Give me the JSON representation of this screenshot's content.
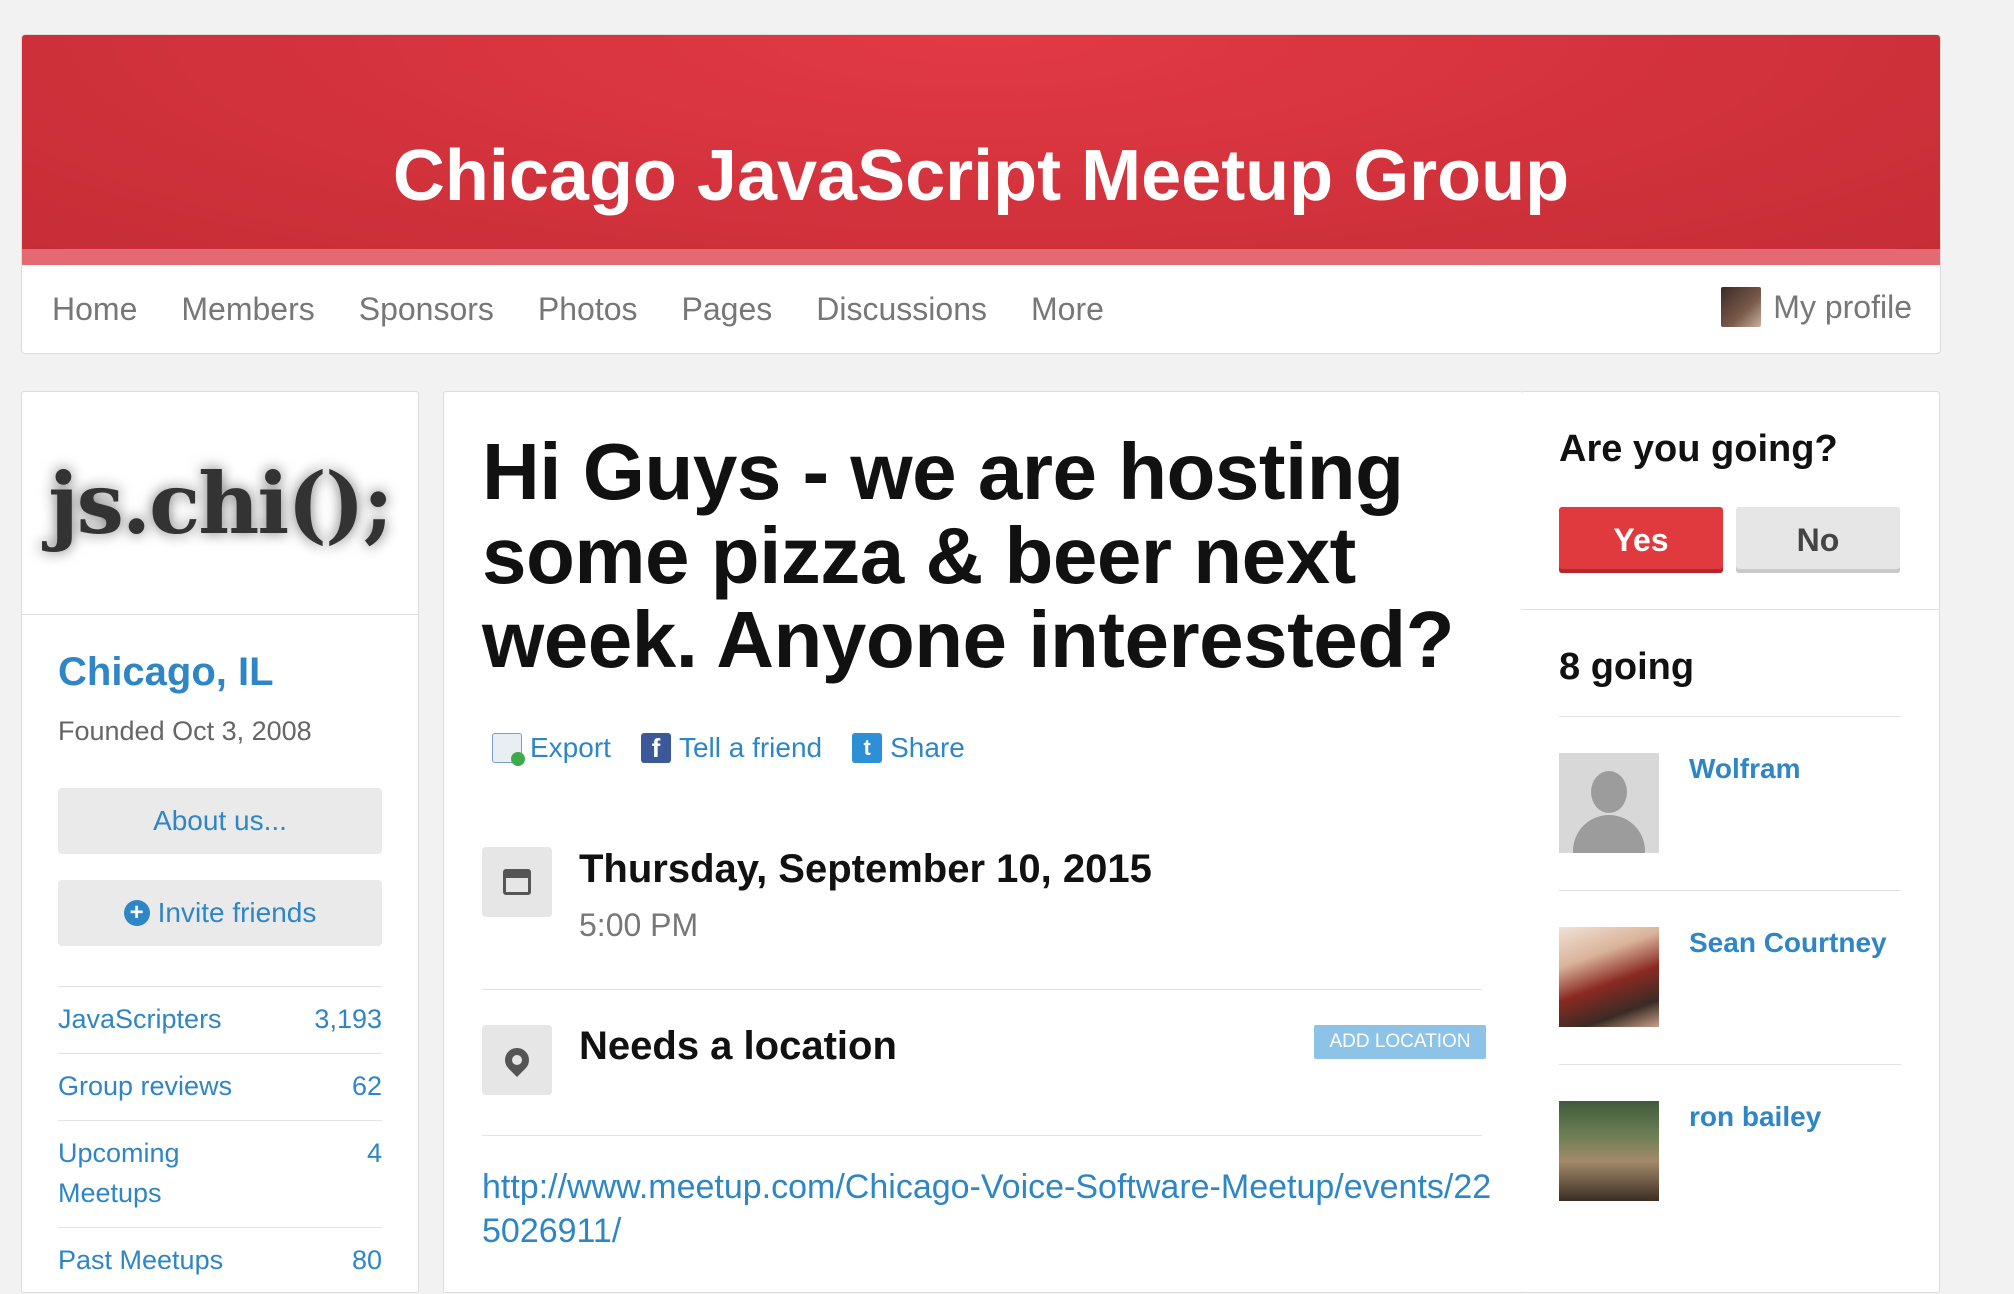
{
  "header": {
    "group_title": "Chicago JavaScript Meetup Group",
    "nav": [
      "Home",
      "Members",
      "Sponsors",
      "Photos",
      "Pages",
      "Discussions",
      "More"
    ],
    "profile_label": "My profile"
  },
  "sidebar": {
    "logo_text": "js.chi();",
    "city": "Chicago, IL",
    "founded": "Founded Oct 3, 2008",
    "about_button": "About us...",
    "invite_button": "Invite friends",
    "stats": [
      {
        "label": "JavaScripters",
        "value": "3,193"
      },
      {
        "label": "Group reviews",
        "value": "62"
      },
      {
        "label": "Upcoming Meetups",
        "value": "4"
      },
      {
        "label": "Past Meetups",
        "value": "80"
      }
    ]
  },
  "event": {
    "title": "Hi Guys - we are hosting some pizza & beer next week. Anyone interested?",
    "actions": {
      "export": "Export",
      "tell_friend": "Tell a friend",
      "share": "Share"
    },
    "date": "Thursday, September 10, 2015",
    "time": "5:00 PM",
    "location": "Needs a location",
    "add_location": "ADD LOCATION",
    "url": "http://www.meetup.com/Chicago-Voice-Software-Meetup/events/225026911/"
  },
  "rsvp": {
    "question": "Are you going?",
    "yes": "Yes",
    "no": "No",
    "going_count": "8 going",
    "attendees": [
      "Wolfram",
      "Sean Courtney",
      "ron bailey"
    ]
  }
}
